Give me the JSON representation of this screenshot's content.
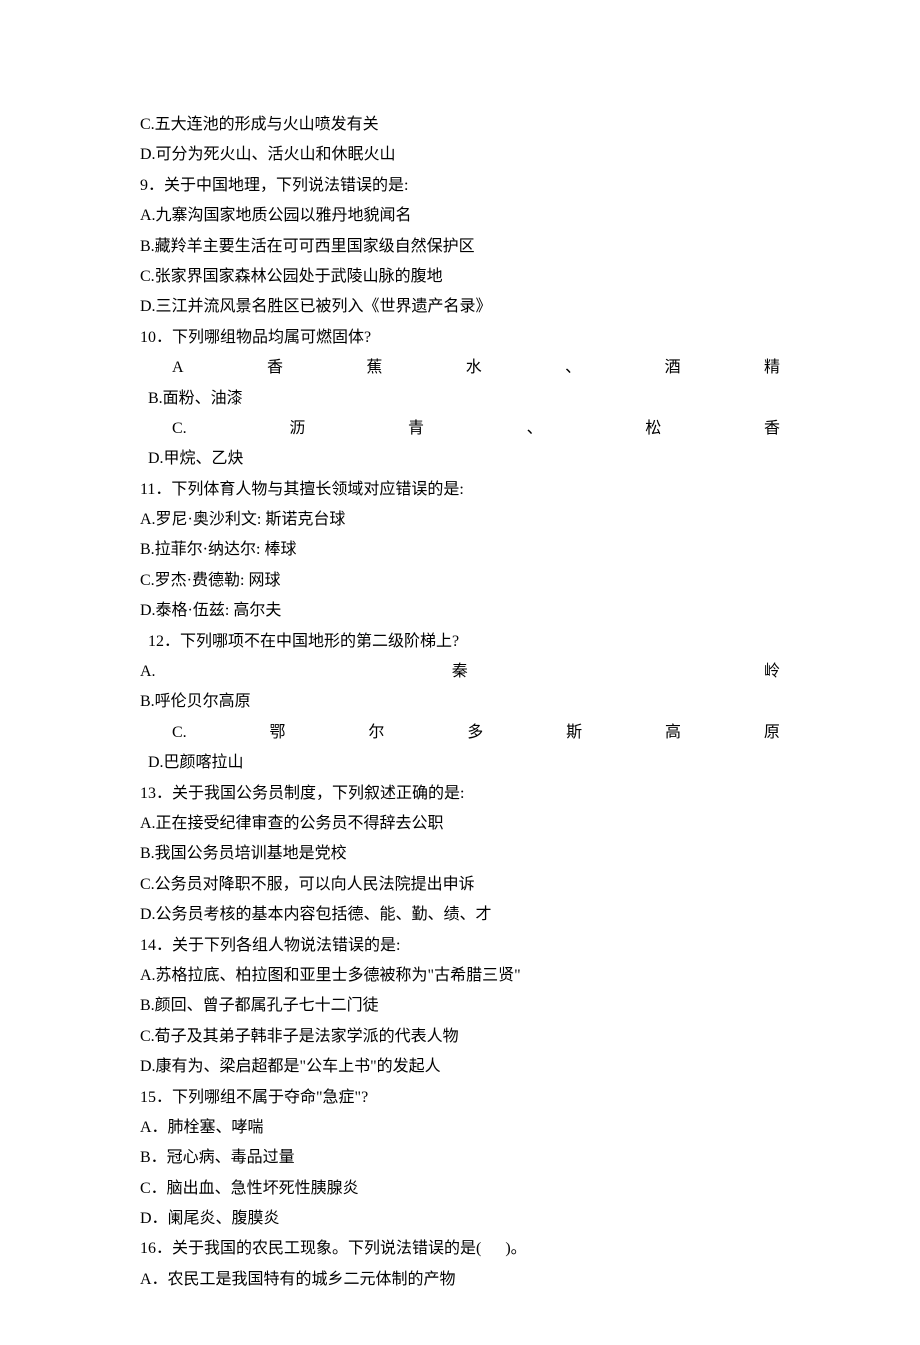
{
  "lines": {
    "l1": "C.五大连池的形成与火山喷发有关",
    "l2": "D.可分为死火山、活火山和休眠火山",
    "l3": "9．关于中国地理，下列说法错误的是:",
    "l4": "A.九寨沟国家地质公园以雅丹地貌闻名",
    "l5": "B.藏羚羊主要生活在可可西里国家级自然保护区",
    "l6": "C.张家界国家森林公园处于武陵山脉的腹地",
    "l7": "D.三江并流风景名胜区已被列入《世界遗产名录》",
    "l8": "10．下列哪组物品均属可燃固体?",
    "l9a": "A",
    "l9b": "香",
    "l9c": "蕉",
    "l9d": "水",
    "l9e": "、",
    "l9f": "酒",
    "l9g": "精",
    "l10": "",
    "l11": "  B.面粉、油漆",
    "l12a": "C.",
    "l12b": "沥",
    "l12c": "青",
    "l12d": "、",
    "l12e": "松",
    "l12f": "香",
    "l13": "",
    "l14": "  D.甲烷、乙炔",
    "l15": "11．下列体育人物与其擅长领域对应错误的是:",
    "l16": "A.罗尼·奥沙利文: 斯诺克台球",
    "l17": "B.拉菲尔·纳达尔: 棒球",
    "l18": "C.罗杰·费德勒: 网球",
    "l19": "D.泰格·伍兹: 高尔夫",
    "l20": "  12．下列哪项不在中国地形的第二级阶梯上?",
    "l21a": "A.",
    "l21b": "秦",
    "l21c": "岭",
    "l22": "",
    "l23": "",
    "l24": "B.呼伦贝尔高原",
    "l25a": "C.",
    "l25b": "鄂",
    "l25c": "尔",
    "l25d": "多",
    "l25e": "斯",
    "l25f": "高",
    "l25g": "原",
    "l26": "",
    "l27": "  D.巴颜喀拉山",
    "l28": "13．关于我国公务员制度，下列叙述正确的是:",
    "l29": "A.正在接受纪律审查的公务员不得辞去公职",
    "l30": "B.我国公务员培训基地是党校",
    "l31": "C.公务员对降职不服，可以向人民法院提出申诉",
    "l32": "D.公务员考核的基本内容包括德、能、勤、绩、才",
    "l33": "14．关于下列各组人物说法错误的是:",
    "l34": "A.苏格拉底、柏拉图和亚里士多德被称为\"古希腊三贤\"",
    "l35": "B.颜回、曾子都属孔子七十二门徒",
    "l36": "C.荀子及其弟子韩非子是法家学派的代表人物",
    "l37": "D.康有为、梁启超都是\"公车上书\"的发起人",
    "l38": "15．下列哪组不属于夺命\"急症\"?",
    "l39": "A．肺栓塞、哮喘",
    "l40": "B．冠心病、毒品过量",
    "l41": "C．脑出血、急性坏死性胰腺炎",
    "l42": "D．阑尾炎、腹膜炎",
    "l43": "16．关于我国的农民工现象。下列说法错误的是(      )。",
    "l44": "A．农民工是我国特有的城乡二元体制的产物"
  }
}
